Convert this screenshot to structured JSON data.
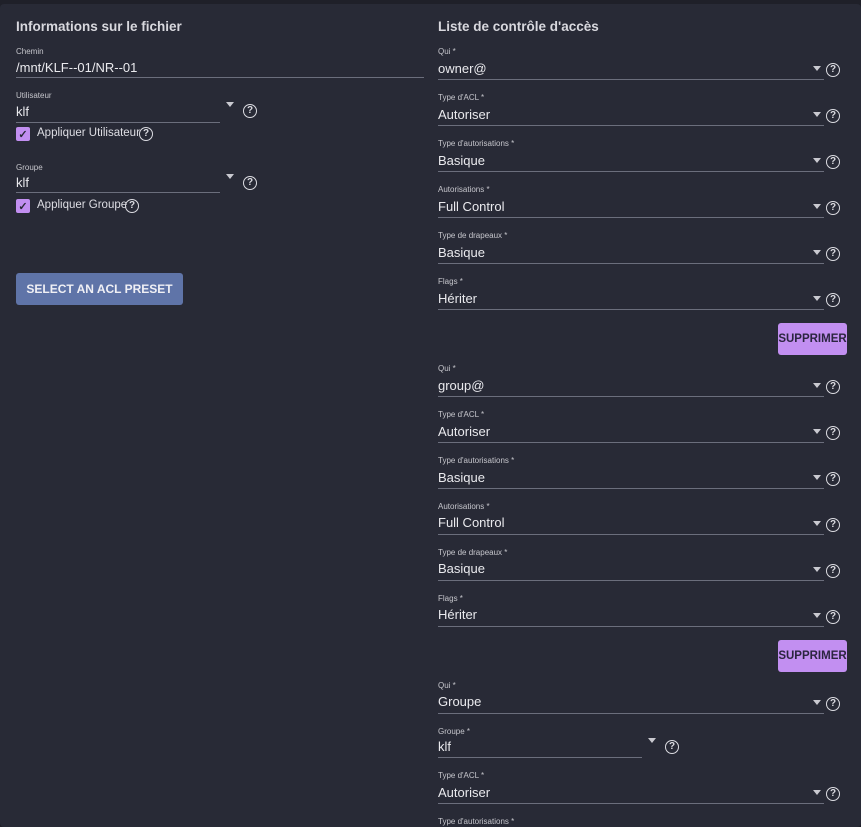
{
  "file_info": {
    "title": "Informations sur le fichier",
    "path_label": "Chemin",
    "path_value": "/mnt/KLF--01/NR--01",
    "user_label": "Utilisateur",
    "user_value": "klf",
    "apply_user_label": "Appliquer Utilisateur",
    "group_label": "Groupe",
    "group_value": "klf",
    "apply_group_label": "Appliquer Groupe",
    "preset_button": "SELECT AN ACL PRESET"
  },
  "acl": {
    "title": "Liste de contrôle d'accès",
    "delete_label": "SUPPRIMER",
    "entries": [
      {
        "who_label": "Qui *",
        "who": "owner@",
        "type_label": "Type d'ACL *",
        "type": "Autoriser",
        "perm_type_label": "Type d'autorisations *",
        "perm_type": "Basique",
        "perm_label": "Autorisations *",
        "perm": "Full Control",
        "flags_type_label": "Type de drapeaux *",
        "flags_type": "Basique",
        "flags_label": "Flags *",
        "flags": "Hériter"
      },
      {
        "who_label": "Qui *",
        "who": "group@",
        "type_label": "Type d'ACL *",
        "type": "Autoriser",
        "perm_type_label": "Type d'autorisations *",
        "perm_type": "Basique",
        "perm_label": "Autorisations *",
        "perm": "Full Control",
        "flags_type_label": "Type de drapeaux *",
        "flags_type": "Basique",
        "flags_label": "Flags *",
        "flags": "Hériter"
      },
      {
        "who_label": "Qui *",
        "who": "Groupe",
        "group_label": "Groupe *",
        "group": "klf",
        "type_label": "Type d'ACL *",
        "type": "Autoriser",
        "perm_type_label": "Type d'autorisations *"
      }
    ]
  },
  "colors": {
    "accent": "#c28ff1",
    "preset_button": "#5f74a8",
    "panel": "#282a36",
    "background": "#1f2029"
  },
  "icons": {
    "help": "help-circle-icon",
    "dropdown": "chevron-down-icon",
    "check": "check-icon"
  }
}
